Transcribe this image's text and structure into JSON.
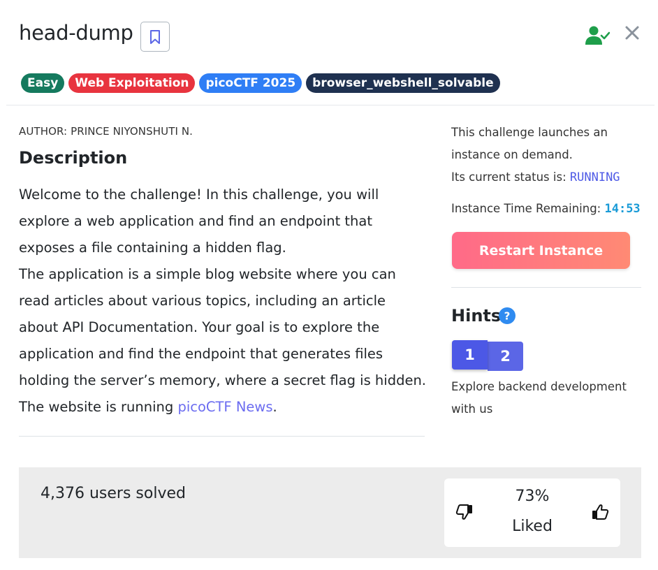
{
  "header": {
    "title": "head-dump"
  },
  "tags": [
    {
      "label": "Easy",
      "color": "#157a5e"
    },
    {
      "label": "Web Exploitation",
      "color": "#e8343f"
    },
    {
      "label": "picoCTF 2025",
      "color": "#2f7ef5"
    },
    {
      "label": "browser_webshell_solvable",
      "color": "#1f3150"
    }
  ],
  "author": "AUTHOR: PRINCE NIYONSHUTI N.",
  "description": {
    "heading": "Description",
    "p1": "Welcome to the challenge! In this challenge, you will explore a web application and find an endpoint that exposes a file containing a hidden flag.",
    "p2": "The application is a simple blog website where you can read articles about various topics, including an article about API Documentation. Your goal is to explore the application and find the endpoint that generates files holding the server’s memory, where a secret flag is hidden.",
    "p3_prefix": "The website is running ",
    "p3_link": "picoCTF News",
    "p3_suffix": "."
  },
  "instance": {
    "launch_text": "This challenge launches an instance on demand.",
    "status_label": "Its current status is:",
    "status_value": "RUNNING",
    "time_label": "Instance Time Remaining:",
    "time_value": "14:53",
    "restart_label": "Restart Instance"
  },
  "hints": {
    "heading": "Hints",
    "tabs": [
      "1",
      "2"
    ],
    "active_tab": "1",
    "text": "Explore backend development with us"
  },
  "footer": {
    "solved": "4,376 users solved",
    "liked_pct": "73%",
    "liked_label": "Liked"
  },
  "colors": {
    "accent": "#5b66e6",
    "status": "#4f5be6",
    "timer": "#1a9bd7",
    "restart_start": "#ff6a88",
    "restart_end": "#ff8a74",
    "user_icon": "#1e9e4a"
  },
  "icons": {
    "bookmark": "bookmark-icon",
    "user_check": "user-check-icon",
    "close": "close-icon",
    "help": "help-icon",
    "thumbs_down": "thumbs-down-icon",
    "thumbs_up": "thumbs-up-icon"
  }
}
